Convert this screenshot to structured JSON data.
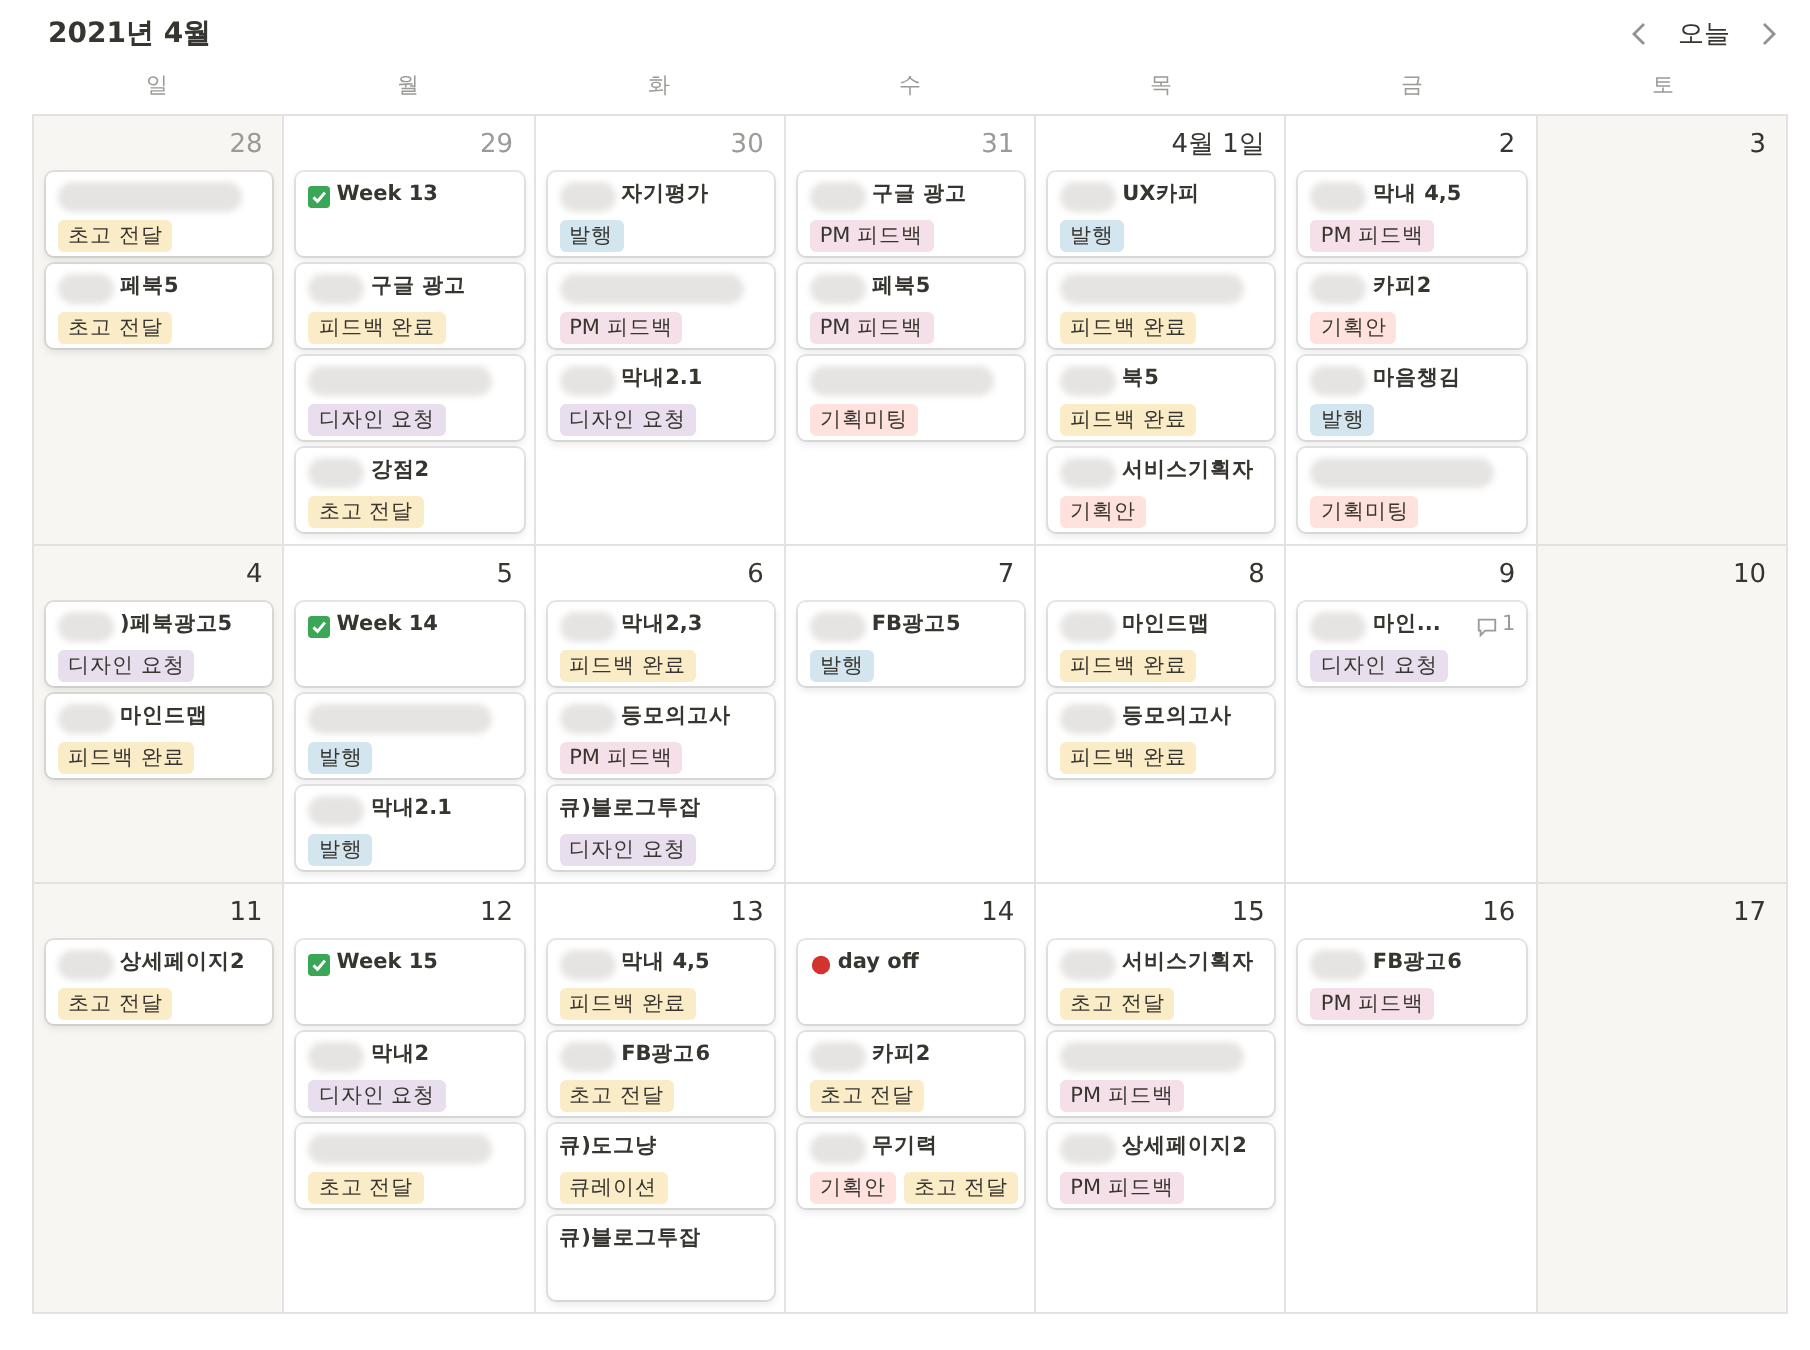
{
  "header": {
    "title": "2021년 4월",
    "today": "오늘"
  },
  "weekdays": [
    "일",
    "월",
    "화",
    "수",
    "목",
    "금",
    "토"
  ],
  "weeks": [
    {
      "days": [
        {
          "label": "28",
          "weekend": true,
          "outside": true,
          "cards": [
            {
              "redacted": true,
              "tags": [
                {
                  "text": "초고 전달",
                  "color": "#fbecc8"
                }
              ]
            },
            {
              "redacted": true,
              "title": "페북5",
              "tags": [
                {
                  "text": "초고 전달",
                  "color": "#fbecc8"
                }
              ]
            }
          ]
        },
        {
          "label": "29",
          "weekend": false,
          "outside": true,
          "cards": [
            {
              "kind": "check",
              "title": "Week 13"
            },
            {
              "redacted": true,
              "title": "구글 광고",
              "tags": [
                {
                  "text": "피드백 완료",
                  "color": "#fbecc8"
                }
              ]
            },
            {
              "redacted": true,
              "tags": [
                {
                  "text": "디자인 요청",
                  "color": "#e8deee"
                }
              ]
            },
            {
              "redacted": true,
              "title": "강점2",
              "tags": [
                {
                  "text": "초고 전달",
                  "color": "#fbecc8"
                }
              ]
            }
          ]
        },
        {
          "label": "30",
          "weekend": false,
          "outside": true,
          "cards": [
            {
              "redacted": true,
              "title": "자기평가",
              "tags": [
                {
                  "text": "발행",
                  "color": "#d3e5ef"
                }
              ]
            },
            {
              "redacted": true,
              "tags": [
                {
                  "text": "PM 피드백",
                  "color": "#f5e0e9"
                }
              ]
            },
            {
              "redacted": true,
              "title": "막내2.1",
              "tags": [
                {
                  "text": "디자인 요청",
                  "color": "#e8deee"
                }
              ]
            }
          ]
        },
        {
          "label": "31",
          "weekend": false,
          "outside": true,
          "cards": [
            {
              "redacted": true,
              "title": "구글 광고",
              "tags": [
                {
                  "text": "PM 피드백",
                  "color": "#f5e0e9"
                }
              ]
            },
            {
              "redacted": true,
              "title": "페북5",
              "tags": [
                {
                  "text": "PM 피드백",
                  "color": "#f5e0e9"
                }
              ]
            },
            {
              "redacted": true,
              "tags": [
                {
                  "text": "기획미팅",
                  "color": "#ffe2dd"
                }
              ]
            }
          ]
        },
        {
          "label": "4월 1일",
          "weekend": false,
          "outside": false,
          "cards": [
            {
              "redacted": true,
              "title": "UX카피",
              "tags": [
                {
                  "text": "발행",
                  "color": "#d3e5ef"
                }
              ]
            },
            {
              "redacted": true,
              "tags": [
                {
                  "text": "피드백 완료",
                  "color": "#fbecc8"
                }
              ]
            },
            {
              "redacted": true,
              "title": "북5",
              "tags": [
                {
                  "text": "피드백 완료",
                  "color": "#fbecc8"
                }
              ]
            },
            {
              "redacted": true,
              "title": "서비스기획자",
              "tags": [
                {
                  "text": "기획안",
                  "color": "#ffe2dd"
                }
              ]
            }
          ]
        },
        {
          "label": "2",
          "weekend": false,
          "outside": false,
          "cards": [
            {
              "redacted": true,
              "title": "막내 4,5",
              "tags": [
                {
                  "text": "PM 피드백",
                  "color": "#f5e0e9"
                }
              ]
            },
            {
              "redacted": true,
              "title": "카피2",
              "tags": [
                {
                  "text": "기획안",
                  "color": "#ffe2dd"
                }
              ]
            },
            {
              "redacted": true,
              "title": "마음챙김",
              "tags": [
                {
                  "text": "발행",
                  "color": "#d3e5ef"
                }
              ]
            },
            {
              "redacted": true,
              "tags": [
                {
                  "text": "기획미팅",
                  "color": "#ffe2dd"
                }
              ]
            }
          ]
        },
        {
          "label": "3",
          "weekend": true,
          "outside": false
        }
      ]
    },
    {
      "days": [
        {
          "label": "4",
          "weekend": true,
          "outside": false,
          "cards": [
            {
              "redacted": true,
              "title": ")페북광고5",
              "tags": [
                {
                  "text": "디자인 요청",
                  "color": "#e8deee"
                }
              ]
            },
            {
              "redacted": true,
              "title": "마인드맵",
              "tags": [
                {
                  "text": "피드백 완료",
                  "color": "#fbecc8"
                }
              ]
            }
          ]
        },
        {
          "label": "5",
          "weekend": false,
          "outside": false,
          "cards": [
            {
              "kind": "check",
              "title": "Week 14"
            },
            {
              "redacted": true,
              "tags": [
                {
                  "text": "발행",
                  "color": "#d3e5ef"
                }
              ]
            },
            {
              "redacted": true,
              "title": "막내2.1",
              "tags": [
                {
                  "text": "발행",
                  "color": "#d3e5ef"
                }
              ]
            }
          ]
        },
        {
          "label": "6",
          "weekend": false,
          "outside": false,
          "cards": [
            {
              "redacted": true,
              "title": "막내2,3",
              "tags": [
                {
                  "text": "피드백 완료",
                  "color": "#fbecc8"
                }
              ]
            },
            {
              "redacted": true,
              "title": "등모의고사",
              "tags": [
                {
                  "text": "PM 피드백",
                  "color": "#f5e0e9"
                }
              ]
            },
            {
              "redacted": false,
              "title": "큐)블로그투잡",
              "tags": [
                {
                  "text": "디자인 요청",
                  "color": "#e8deee"
                }
              ]
            }
          ]
        },
        {
          "label": "7",
          "weekend": false,
          "outside": false,
          "cards": [
            {
              "redacted": true,
              "title": "FB광고5",
              "tags": [
                {
                  "text": "발행",
                  "color": "#d3e5ef"
                }
              ]
            }
          ]
        },
        {
          "label": "8",
          "weekend": false,
          "outside": false,
          "cards": [
            {
              "redacted": true,
              "title": "마인드맵",
              "tags": [
                {
                  "text": "피드백 완료",
                  "color": "#fbecc8"
                }
              ]
            },
            {
              "redacted": true,
              "title": "등모의고사",
              "tags": [
                {
                  "text": "피드백 완료",
                  "color": "#fbecc8"
                }
              ]
            }
          ]
        },
        {
          "label": "9",
          "weekend": false,
          "outside": false,
          "cards": [
            {
              "redacted": true,
              "title": "마인...",
              "comments": "1",
              "tags": [
                {
                  "text": "디자인 요청",
                  "color": "#e8deee"
                }
              ]
            }
          ]
        },
        {
          "label": "10",
          "weekend": true,
          "outside": false
        }
      ]
    },
    {
      "days": [
        {
          "label": "11",
          "weekend": true,
          "outside": false,
          "cards": [
            {
              "redacted": true,
              "title": "상세페이지2",
              "tags": [
                {
                  "text": "초고 전달",
                  "color": "#fbecc8"
                }
              ]
            }
          ]
        },
        {
          "label": "12",
          "weekend": false,
          "outside": false,
          "cards": [
            {
              "kind": "check",
              "title": "Week 15"
            },
            {
              "redacted": true,
              "title": "막내2",
              "tags": [
                {
                  "text": "디자인 요청",
                  "color": "#e8deee"
                }
              ]
            },
            {
              "redacted": true,
              "tags": [
                {
                  "text": "초고 전달",
                  "color": "#fbecc8"
                }
              ]
            }
          ]
        },
        {
          "label": "13",
          "weekend": false,
          "outside": false,
          "cards": [
            {
              "redacted": true,
              "title": "막내 4,5",
              "tags": [
                {
                  "text": "피드백 완료",
                  "color": "#fbecc8"
                }
              ]
            },
            {
              "redacted": true,
              "title": "FB광고6",
              "tags": [
                {
                  "text": "초고 전달",
                  "color": "#fbecc8"
                }
              ]
            },
            {
              "redacted": false,
              "title": "큐)도그냥",
              "tags": [
                {
                  "text": "큐레이션",
                  "color": "#fbecc8"
                }
              ]
            },
            {
              "redacted": false,
              "title": "큐)블로그투잡"
            }
          ]
        },
        {
          "label": "14",
          "weekend": false,
          "outside": false,
          "cards": [
            {
              "kind": "dot",
              "title": "day off"
            },
            {
              "redacted": true,
              "title": "카피2",
              "tags": [
                {
                  "text": "초고 전달",
                  "color": "#fbecc8"
                }
              ]
            },
            {
              "redacted": true,
              "title": "무기력",
              "tags": [
                {
                  "text": "기획안",
                  "color": "#ffe2dd"
                },
                {
                  "text": "초고 전달",
                  "color": "#fbecc8"
                }
              ]
            }
          ]
        },
        {
          "label": "15",
          "weekend": false,
          "outside": false,
          "cards": [
            {
              "redacted": true,
              "title": "서비스기획자",
              "tags": [
                {
                  "text": "초고 전달",
                  "color": "#fbecc8"
                }
              ]
            },
            {
              "redacted": true,
              "tags": [
                {
                  "text": "PM 피드백",
                  "color": "#f5e0e9"
                }
              ]
            },
            {
              "redacted": true,
              "title": "상세페이지2",
              "tags": [
                {
                  "text": "PM 피드백",
                  "color": "#f5e0e9"
                }
              ]
            }
          ]
        },
        {
          "label": "16",
          "weekend": false,
          "outside": false,
          "cards": [
            {
              "redacted": true,
              "title": "FB광고6",
              "tags": [
                {
                  "text": "PM 피드백",
                  "color": "#f5e0e9"
                }
              ]
            }
          ]
        },
        {
          "label": "17",
          "weekend": true,
          "outside": false
        }
      ]
    }
  ]
}
